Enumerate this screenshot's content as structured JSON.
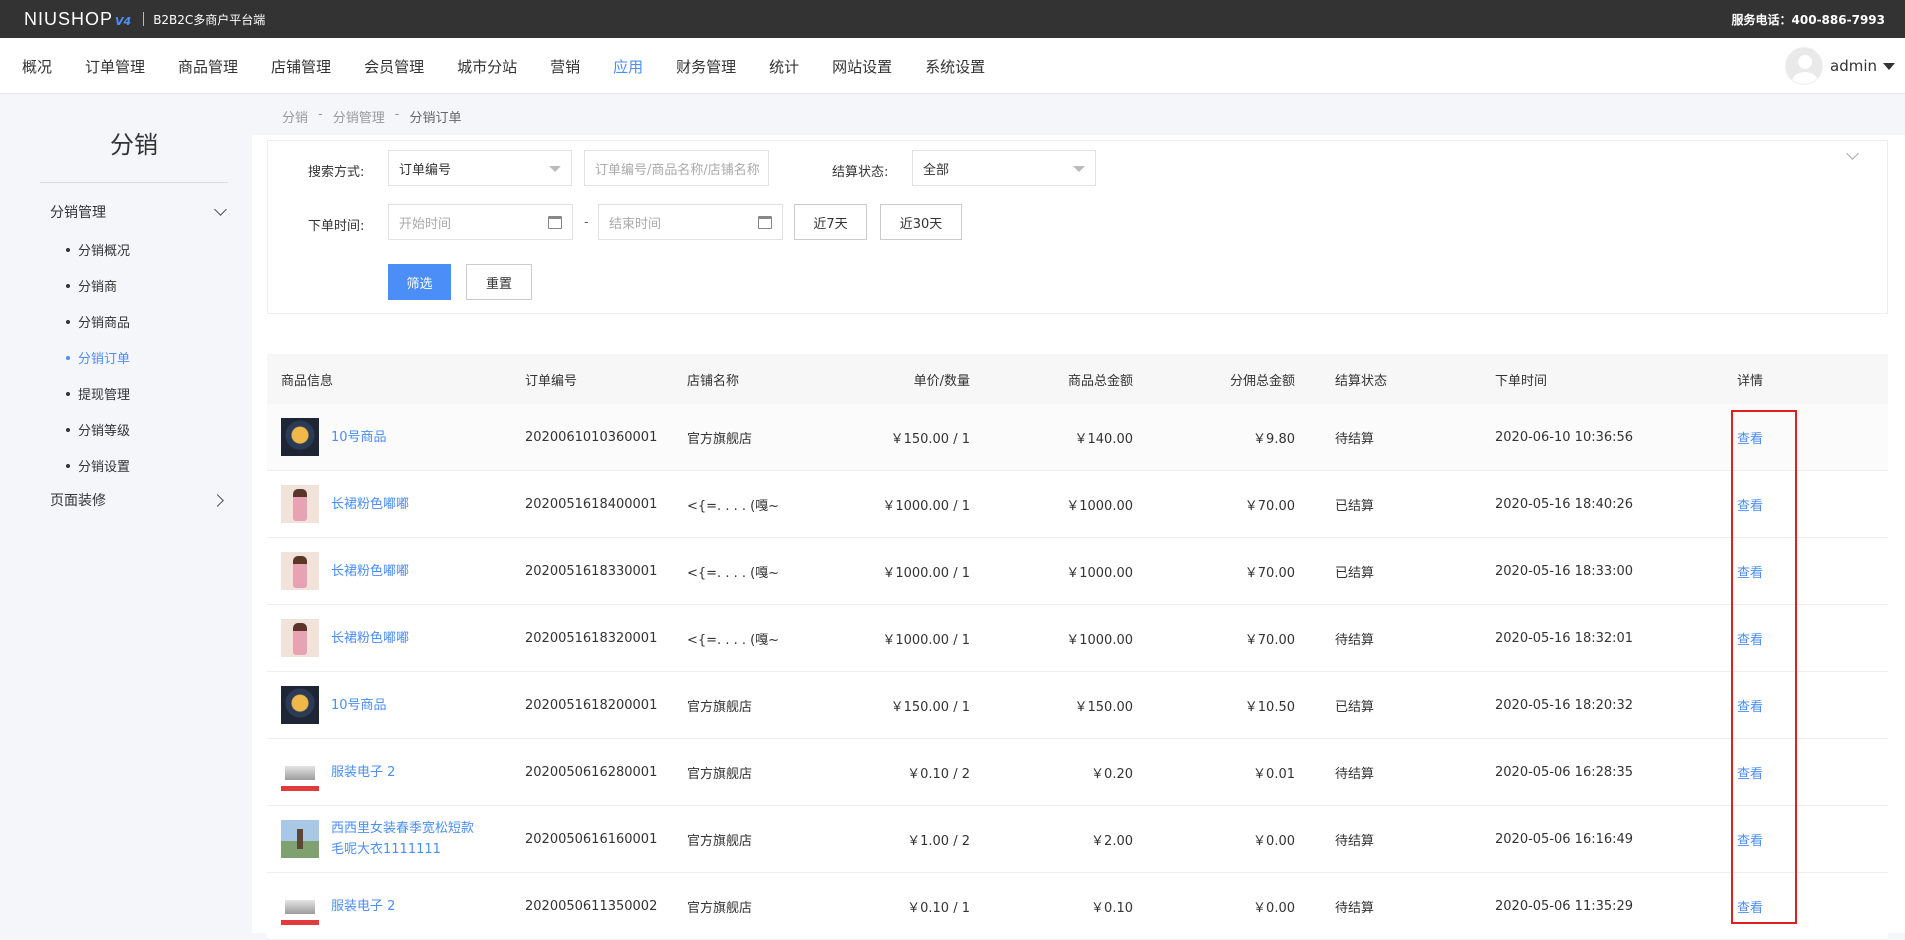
{
  "topbar": {
    "logo": "NIUSHOP",
    "logo_version": "V4",
    "subtitle": "B2B2C多商户平台端",
    "service_phone": "服务电话：400-886-7993"
  },
  "nav": {
    "items": [
      {
        "label": "概况"
      },
      {
        "label": "订单管理"
      },
      {
        "label": "商品管理"
      },
      {
        "label": "店铺管理"
      },
      {
        "label": "会员管理"
      },
      {
        "label": "城市分站"
      },
      {
        "label": "营销"
      },
      {
        "label": "应用"
      },
      {
        "label": "财务管理"
      },
      {
        "label": "统计"
      },
      {
        "label": "网站设置"
      },
      {
        "label": "系统设置"
      }
    ],
    "active": "应用",
    "user": "admin"
  },
  "sidebar": {
    "title": "分销",
    "group1": "分销管理",
    "items": [
      {
        "label": "分销概况"
      },
      {
        "label": "分销商"
      },
      {
        "label": "分销商品"
      },
      {
        "label": "分销订单"
      },
      {
        "label": "提现管理"
      },
      {
        "label": "分销等级"
      },
      {
        "label": "分销设置"
      }
    ],
    "active": "分销订单",
    "group2": "页面装修"
  },
  "breadcrumb": {
    "items": [
      "分销",
      "-",
      "分销管理",
      "-",
      "分销订单"
    ]
  },
  "filter": {
    "search_label": "搜索方式:",
    "search_type": "订单编号",
    "keyword_placeholder": "订单编号/商品名称/店铺名称",
    "settle_label": "结算状态:",
    "settle_value": "全部",
    "time_label": "下单时间:",
    "start_placeholder": "开始时间",
    "dash": "-",
    "end_placeholder": "结束时间",
    "btn_7days": "近7天",
    "btn_30days": "近30天",
    "btn_filter": "筛选",
    "btn_reset": "重置"
  },
  "table": {
    "headers": [
      "商品信息",
      "订单编号",
      "店铺名称",
      "单价/数量",
      "商品总金额",
      "分佣总金额",
      "结算状态",
      "下单时间",
      "详情"
    ],
    "rows": [
      {
        "thumb": "bouquet",
        "name": "10号商品",
        "order_no": "2020061010360001",
        "shop": "官方旗舰店",
        "price_qty": "￥150.00 / 1",
        "total": "￥140.00",
        "commission": "￥9.80",
        "status": "待结算",
        "time": "2020-06-10 10:36:56",
        "action": "查看"
      },
      {
        "thumb": "dress",
        "name": "长裙粉色嘟嘟",
        "order_no": "2020051618400001",
        "shop": "<{=. . . . (嘎~",
        "price_qty": "￥1000.00 / 1",
        "total": "￥1000.00",
        "commission": "￥70.00",
        "status": "已结算",
        "time": "2020-05-16 18:40:26",
        "action": "查看"
      },
      {
        "thumb": "dress",
        "name": "长裙粉色嘟嘟",
        "order_no": "2020051618330001",
        "shop": "<{=. . . . (嘎~",
        "price_qty": "￥1000.00 / 1",
        "total": "￥1000.00",
        "commission": "￥70.00",
        "status": "已结算",
        "time": "2020-05-16 18:33:00",
        "action": "查看"
      },
      {
        "thumb": "dress",
        "name": "长裙粉色嘟嘟",
        "order_no": "2020051618320001",
        "shop": "<{=. . . . (嘎~",
        "price_qty": "￥1000.00 / 1",
        "total": "￥1000.00",
        "commission": "￥70.00",
        "status": "待结算",
        "time": "2020-05-16 18:32:01",
        "action": "查看"
      },
      {
        "thumb": "bouquet",
        "name": "10号商品",
        "order_no": "2020051618200001",
        "shop": "官方旗舰店",
        "price_qty": "￥150.00 / 1",
        "total": "￥150.00",
        "commission": "￥10.50",
        "status": "已结算",
        "time": "2020-05-16 18:20:32",
        "action": "查看"
      },
      {
        "thumb": "electro",
        "name": "服装电子 2",
        "order_no": "2020050616280001",
        "shop": "官方旗舰店",
        "price_qty": "￥0.10 / 2",
        "total": "￥0.20",
        "commission": "￥0.01",
        "status": "待结算",
        "time": "2020-05-06 16:28:35",
        "action": "查看"
      },
      {
        "thumb": "scenery",
        "name": "西西里女装春季宽松短款毛呢大衣1111111",
        "name_line1": "西西里女装春季宽松短款",
        "name_line2": "毛呢大衣1111111",
        "order_no": "2020050616160001",
        "shop": "官方旗舰店",
        "price_qty": "￥1.00 / 2",
        "total": "￥2.00",
        "commission": "￥0.00",
        "status": "待结算",
        "time": "2020-05-06 16:16:49",
        "action": "查看"
      },
      {
        "thumb": "electro",
        "name": "服装电子 2",
        "order_no": "2020050611350002",
        "shop": "官方旗舰店",
        "price_qty": "￥0.10 / 1",
        "total": "￥0.10",
        "commission": "￥0.00",
        "status": "待结算",
        "time": "2020-05-06 11:35:29",
        "action": "查看"
      }
    ]
  },
  "colors": {
    "accent": "#4b8ef8",
    "topbar": "#333333",
    "highlight_box": "#e02020"
  }
}
